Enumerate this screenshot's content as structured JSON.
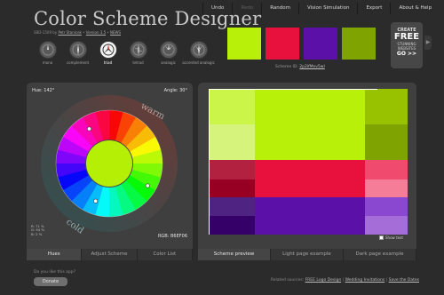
{
  "header": {
    "title": "Color Scheme Designer",
    "subtitle_prefix": "SBD-1509 ",
    "subtitle_author": "Petr Stanicek",
    "subtitle_version": "Version 3.5",
    "subtitle_news": "NEWS"
  },
  "menu": [
    {
      "label": "Undo",
      "enabled": true
    },
    {
      "label": "Redo",
      "enabled": false
    },
    {
      "label": "Random",
      "enabled": true
    },
    {
      "label": "Vision Simulation",
      "enabled": true
    },
    {
      "label": "Export",
      "enabled": true
    },
    {
      "label": "About & Help",
      "enabled": true
    }
  ],
  "modes": [
    {
      "label": "mono",
      "selected": false
    },
    {
      "label": "complement",
      "selected": false
    },
    {
      "label": "triad",
      "selected": true
    },
    {
      "label": "tetrad",
      "selected": false
    },
    {
      "label": "analogic",
      "selected": false
    },
    {
      "label": "accented analogic",
      "selected": false
    }
  ],
  "swatches": [
    "#B8F00A",
    "#E8113E",
    "#5B10A8",
    "#7FA300"
  ],
  "scheme": {
    "label": "Scheme ID:",
    "id": "2p2ifMvv5wI"
  },
  "promo": {
    "line1": "CREATE",
    "line2": "FREE",
    "line3": "STUNNING",
    "line4": "WEBSITES",
    "line5": "GO >>"
  },
  "left_panel": {
    "hue_label": "Hue: 142°",
    "angle_label": "Angle: 30°",
    "warm": "warm",
    "cold": "cold",
    "rgb_label": "RGB: B6EF06",
    "rgb_values": "R: 71 %\nG: 94 %\nB: 2 %",
    "tabs": [
      "Hues",
      "Adjust Scheme",
      "Color List"
    ],
    "active_tab": 0
  },
  "right_panel": {
    "show_text": "Show text",
    "tabs": [
      "Scheme preview",
      "Light page example",
      "Dark page example"
    ],
    "active_tab": 0,
    "palette": {
      "primary": [
        "#B8F00A",
        "#CCF54A",
        "#D6F47C",
        "#98C200",
        "#7FA300"
      ],
      "secondary_a": [
        "#E8113E",
        "#B2213F",
        "#970023",
        "#F04A6E",
        "#F57D97"
      ],
      "secondary_b": [
        "#5B10A8",
        "#4E2381",
        "#350067",
        "#8A47D0",
        "#A56DD8"
      ]
    }
  },
  "footer": {
    "question": "Do you like this app?",
    "donate": "Donate",
    "related": "Related sources:",
    "links": [
      "FREE Logo Design",
      "Wedding Invitations",
      "Save the Dates"
    ]
  }
}
